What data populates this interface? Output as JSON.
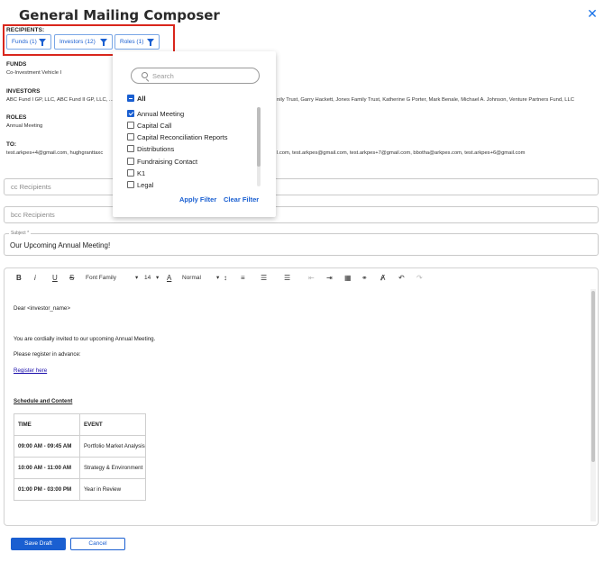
{
  "title": "General Mailing Composer",
  "close_icon": "close-icon",
  "recipients": {
    "label": "RECIPIENTS:",
    "chips": [
      {
        "label": "Funds (1)"
      },
      {
        "label": "Investors (12)"
      },
      {
        "label": "Roles (1)"
      }
    ]
  },
  "funds": {
    "heading": "FUNDS",
    "value": "Co-Investment Vehicle I"
  },
  "investors": {
    "heading": "INVESTORS",
    "value_left": "ABC Fund I GP, LLC, ABC Fund II GP, LLC, ...",
    "value_right": "nily Trust, Garry Hackett, Jones Family Trust, Katherine G Porter, Mark Benale, Michael A. Johnson, Venture Partners Fund, LLC"
  },
  "roles": {
    "heading": "ROLES",
    "value": "Annual Meeting"
  },
  "to": {
    "heading": "TO:",
    "value_left": "test.arkpes+4@gmail.com, hughgranttaxc",
    "value_right": "l.com, test.arkpes@gmail.com, test.arkpes+7@gmail.com, bbotha@arkpes.com, test.arkpes+6@gmail.com"
  },
  "cc": {
    "placeholder": "cc Recipients"
  },
  "bcc": {
    "placeholder": "bcc Recipients"
  },
  "subject": {
    "label": "Subject *",
    "value": "Our Upcoming Annual Meeting!"
  },
  "toolbar": {
    "bold": "B",
    "italic": "i",
    "underline": "U",
    "strike": "S",
    "font_family": "Font Family",
    "font_size": "14",
    "text_color": "A",
    "block_format": "Normal"
  },
  "email_body": {
    "greeting": "Dear <investor_name>",
    "line1": "You are cordially invited to our upcoming Annual Meeting.",
    "line2": "Please register in advance:",
    "link": "Register here",
    "schedule_heading": "Schedule and Content",
    "table": {
      "headers": [
        "TIME",
        "EVENT"
      ],
      "rows": [
        [
          "09:00 AM - 09:45 AM",
          "Portfolio Market Analysis"
        ],
        [
          "10:00 AM - 11:00 AM",
          "Strategy & Environment"
        ],
        [
          "01:00 PM - 03:00 PM",
          "Year in Review"
        ]
      ]
    }
  },
  "buttons": {
    "save": "Save Draft",
    "cancel": "Cancel"
  },
  "filter_dropdown": {
    "search_placeholder": "Search",
    "all_label": "All",
    "options": [
      {
        "label": "Annual Meeting",
        "checked": true
      },
      {
        "label": "Capital Call",
        "checked": false
      },
      {
        "label": "Capital Reconciliation Reports",
        "checked": false
      },
      {
        "label": "Distributions",
        "checked": false
      },
      {
        "label": "Fundraising Contact",
        "checked": false
      },
      {
        "label": "K1",
        "checked": false
      },
      {
        "label": "Legal",
        "checked": false
      }
    ],
    "apply_label": "Apply Filter",
    "clear_label": "Clear Filter"
  },
  "colors": {
    "accent": "#1a5fd1",
    "highlight_border": "#d9261c"
  }
}
